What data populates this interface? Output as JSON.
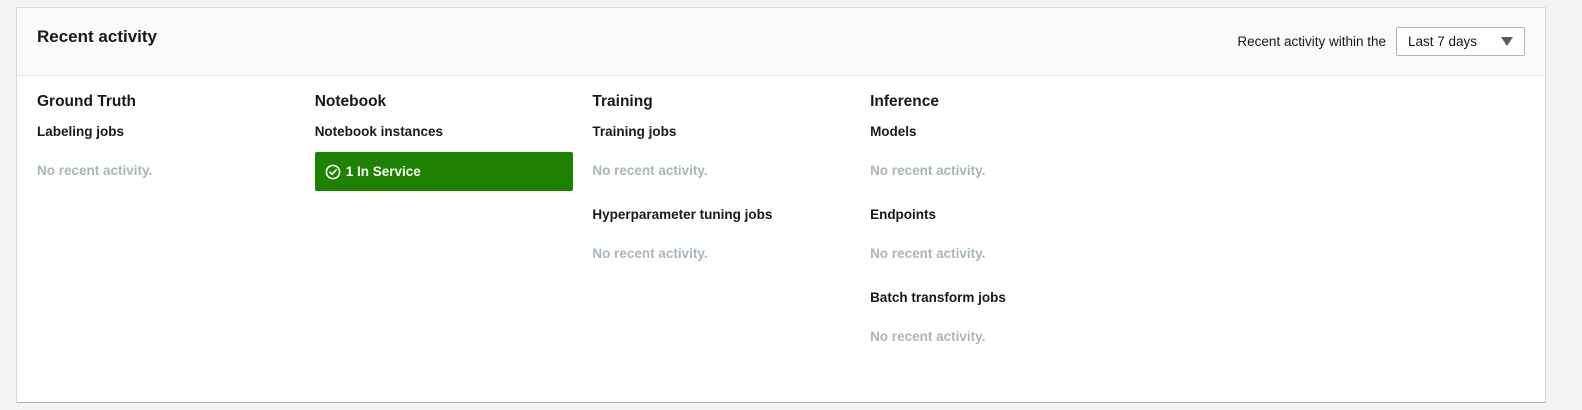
{
  "panel": {
    "title": "Recent activity",
    "range_label": "Recent activity within the",
    "range_value": "Last 7 days"
  },
  "columns": [
    {
      "title": "Ground Truth",
      "sections": [
        {
          "title": "Labeling jobs",
          "empty_text": "No recent activity."
        }
      ]
    },
    {
      "title": "Notebook",
      "sections": [
        {
          "title": "Notebook instances",
          "status": {
            "text": "1 In Service",
            "color": "#1d8102",
            "icon": "check-circle-icon"
          }
        }
      ]
    },
    {
      "title": "Training",
      "sections": [
        {
          "title": "Training jobs",
          "empty_text": "No recent activity."
        },
        {
          "title": "Hyperparameter tuning jobs",
          "empty_text": "No recent activity."
        }
      ]
    },
    {
      "title": "Inference",
      "sections": [
        {
          "title": "Models",
          "empty_text": "No recent activity."
        },
        {
          "title": "Endpoints",
          "empty_text": "No recent activity."
        },
        {
          "title": "Batch transform jobs",
          "empty_text": "No recent activity."
        }
      ]
    }
  ]
}
